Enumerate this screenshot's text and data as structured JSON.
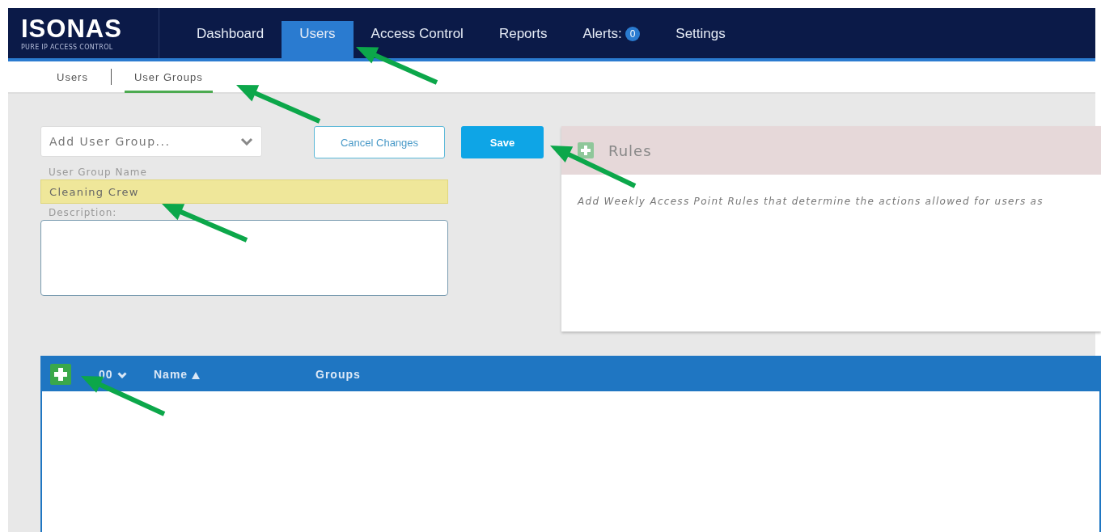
{
  "logo": {
    "name": "ISONAS",
    "tagline": "PURE IP ACCESS CONTROL"
  },
  "nav": [
    {
      "label": "Dashboard",
      "selected": false
    },
    {
      "label": "Users",
      "selected": true
    },
    {
      "label": "Access Control",
      "selected": false
    },
    {
      "label": "Reports",
      "selected": false
    },
    {
      "label": "Alerts:",
      "selected": false,
      "badge": "0"
    },
    {
      "label": "Settings",
      "selected": false
    }
  ],
  "subnav": [
    {
      "label": "Users",
      "selected": false
    },
    {
      "label": "User Groups",
      "selected": true
    }
  ],
  "form": {
    "group_select": {
      "placeholder": "Add User Group..."
    },
    "cancel_button": "Cancel Changes",
    "save_button": "Save",
    "name_label": "User Group Name",
    "name_value": "Cleaning Crew",
    "description_label": "Description:"
  },
  "rules": {
    "title": "Rules",
    "text": "Add Weekly Access Point Rules that determine the actions allowed for users as"
  },
  "table": {
    "columns": [
      {
        "label": "00",
        "sorted_desc": true,
        "sorted_asc": false
      },
      {
        "label": "Name",
        "sorted_desc": false,
        "sorted_asc": true
      },
      {
        "label": "Groups",
        "sorted_desc": false,
        "sorted_asc": false
      }
    ]
  }
}
